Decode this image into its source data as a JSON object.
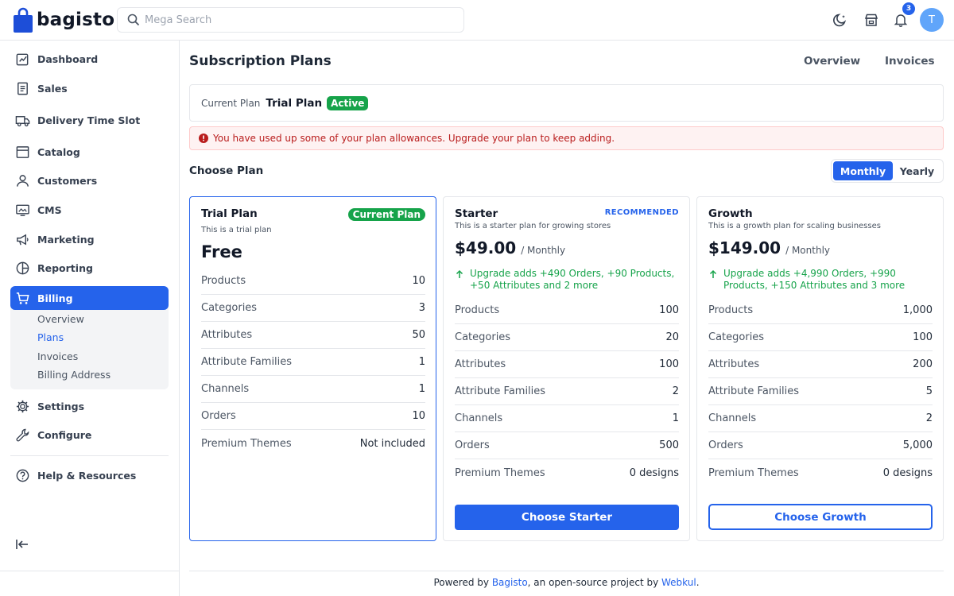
{
  "header": {
    "logo_text": "bagisto",
    "search_placeholder": "Mega Search",
    "notification_count": "3",
    "avatar_initial": "T",
    "icons": [
      "dark-mode-icon",
      "storefront-icon",
      "bell-icon"
    ]
  },
  "sidebar": {
    "items": [
      {
        "label": "Dashboard",
        "icon": "dashboard-icon"
      },
      {
        "label": "Sales",
        "icon": "sales-icon"
      },
      {
        "label": "Delivery Time Slot",
        "icon": "truck-icon"
      },
      {
        "label": "Catalog",
        "icon": "catalog-icon"
      },
      {
        "label": "Customers",
        "icon": "user-icon"
      },
      {
        "label": "CMS",
        "icon": "cms-icon"
      },
      {
        "label": "Marketing",
        "icon": "megaphone-icon"
      },
      {
        "label": "Reporting",
        "icon": "pie-chart-icon"
      },
      {
        "label": "Billing",
        "icon": "cart-icon"
      },
      {
        "label": "Settings",
        "icon": "gear-icon"
      },
      {
        "label": "Configure",
        "icon": "wrench-icon"
      },
      {
        "label": "Help & Resources",
        "icon": "help-icon"
      }
    ],
    "billing_sub": [
      "Overview",
      "Plans",
      "Invoices",
      "Billing Address"
    ]
  },
  "main": {
    "title": "Subscription Plans",
    "tabs": [
      "Overview",
      "Invoices"
    ],
    "current_plan_label": "Current Plan",
    "current_plan_name": "Trial Plan",
    "current_plan_status": "Active",
    "alert": "You have used up some of your plan allowances. Upgrade your plan to keep adding.",
    "choose_plan_title": "Choose Plan",
    "billing_toggle": {
      "monthly": "Monthly",
      "yearly": "Yearly",
      "selected": "Monthly"
    }
  },
  "plans": [
    {
      "name": "Trial Plan",
      "description": "This is a trial plan",
      "badge": "Current Plan",
      "price": "Free",
      "features": [
        {
          "label": "Products",
          "value": "10"
        },
        {
          "label": "Categories",
          "value": "3"
        },
        {
          "label": "Attributes",
          "value": "50"
        },
        {
          "label": "Attribute Families",
          "value": "1"
        },
        {
          "label": "Channels",
          "value": "1"
        },
        {
          "label": "Orders",
          "value": "10"
        },
        {
          "label": "Premium Themes",
          "value": "Not included"
        }
      ]
    },
    {
      "name": "Starter",
      "description": "This is a starter plan for growing stores",
      "tag": "RECOMMENDED",
      "price": "$49.00",
      "period": "/ Monthly",
      "upgrade_note": "Upgrade adds +490 Orders, +90 Products, +50 Attributes and 2 more",
      "features": [
        {
          "label": "Products",
          "value": "100"
        },
        {
          "label": "Categories",
          "value": "20"
        },
        {
          "label": "Attributes",
          "value": "100"
        },
        {
          "label": "Attribute Families",
          "value": "2"
        },
        {
          "label": "Channels",
          "value": "1"
        },
        {
          "label": "Orders",
          "value": "500"
        },
        {
          "label": "Premium Themes",
          "value": "0 designs"
        }
      ],
      "button": "Choose Starter"
    },
    {
      "name": "Growth",
      "description": "This is a growth plan for scaling businesses",
      "price": "$149.00",
      "period": "/ Monthly",
      "upgrade_note": "Upgrade adds +4,990 Orders, +990 Products, +150 Attributes and 3 more",
      "features": [
        {
          "label": "Products",
          "value": "1,000"
        },
        {
          "label": "Categories",
          "value": "100"
        },
        {
          "label": "Attributes",
          "value": "200"
        },
        {
          "label": "Attribute Families",
          "value": "5"
        },
        {
          "label": "Channels",
          "value": "2"
        },
        {
          "label": "Orders",
          "value": "5,000"
        },
        {
          "label": "Premium Themes",
          "value": "0 designs"
        }
      ],
      "button": "Choose Growth"
    }
  ],
  "footer": {
    "prefix": "Powered by ",
    "link1": "Bagisto",
    "middle": ", an open-source project by ",
    "link2": "Webkul",
    "suffix": "."
  },
  "colors": {
    "accent": "#2563eb",
    "success": "#16a34a",
    "danger": "#b91c1c"
  }
}
